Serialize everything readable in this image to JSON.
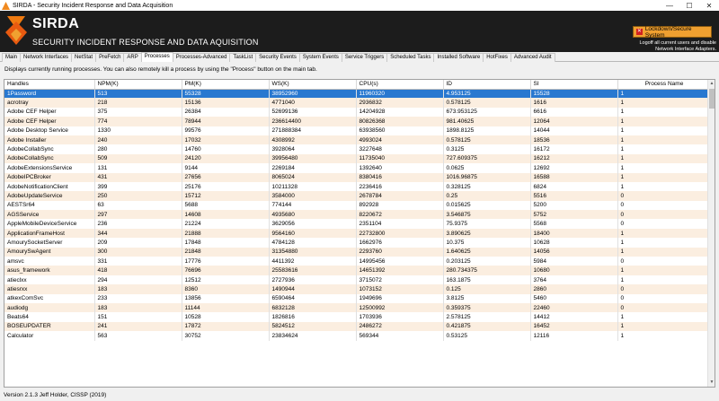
{
  "window": {
    "title": "SIRDA - Security Incident Response and Data Acquisition"
  },
  "header": {
    "brand": "SIRDA",
    "subtitle": "SECURITY INCIDENT RESPONSE AND DATA AQUISITION",
    "lockdown_label": "Lockdown/Secure System",
    "lockdown_info": "Logoff all current users and disable Network Interface Adapters."
  },
  "tabs": [
    "Main",
    "Network Interfaces",
    "NetStat",
    "PreFetch",
    "ARP",
    "Processes",
    "Processes-Advanced",
    "TaskList",
    "Security Events",
    "System Events",
    "Service Triggers",
    "Scheduled Tasks",
    "Installed Software",
    "HotFixes",
    "Advanced Audit"
  ],
  "active_tab": "Processes",
  "description": "Displays currently running processes. You can also remotely kill a process by using the \"Process\" button on the main tab.",
  "table": {
    "columns": [
      "Handles",
      "NPM(K)",
      "PM(K)",
      "WS(K)",
      "CPU(s)",
      "ID",
      "SI",
      "Process Name"
    ],
    "rows": [
      [
        "1Password",
        "513",
        "55328",
        "38952960",
        "11960320",
        "4.953125",
        "15528",
        "1"
      ],
      [
        "acrotray",
        "218",
        "15136",
        "4771040",
        "2936832",
        "0.578125",
        "1616",
        "1"
      ],
      [
        "Adobe CEF Helper",
        "375",
        "26384",
        "52699136",
        "14204928",
        "673.953125",
        "6616",
        "1"
      ],
      [
        "Adobe CEF Helper",
        "774",
        "78944",
        "236614400",
        "80826368",
        "981.40625",
        "12064",
        "1"
      ],
      [
        "Adobe Desktop Service",
        "1330",
        "99576",
        "271888384",
        "63938560",
        "1898.8125",
        "14044",
        "1"
      ],
      [
        "Adobe Installer",
        "240",
        "17032",
        "4308992",
        "4993024",
        "0.578125",
        "18536",
        "1"
      ],
      [
        "AdobeCollabSync",
        "280",
        "14760",
        "3928064",
        "3227648",
        "0.3125",
        "16172",
        "1"
      ],
      [
        "AdobeCollabSync",
        "509",
        "24120",
        "39956480",
        "11735040",
        "727.609375",
        "16212",
        "1"
      ],
      [
        "AdobeExtensionsService",
        "131",
        "9144",
        "2269184",
        "1392640",
        "0.0625",
        "12692",
        "1"
      ],
      [
        "AdobeIPCBroker",
        "431",
        "27656",
        "8065024",
        "8380416",
        "1016.96875",
        "16588",
        "1"
      ],
      [
        "AdobeNotificationClient",
        "399",
        "25176",
        "10211328",
        "2236416",
        "0.328125",
        "6824",
        "1"
      ],
      [
        "AdobeUpdateService",
        "250",
        "15712",
        "3584000",
        "2678784",
        "0.25",
        "5516",
        "0"
      ],
      [
        "AESTSr64",
        "63",
        "5688",
        "774144",
        "892928",
        "0.015625",
        "5200",
        "0"
      ],
      [
        "AGSService",
        "297",
        "14608",
        "4935680",
        "8220672",
        "3.546875",
        "5752",
        "0"
      ],
      [
        "AppleMobileDeviceService",
        "236",
        "21224",
        "3629056",
        "2351104",
        "75.9375",
        "5568",
        "0"
      ],
      [
        "ApplicationFrameHost",
        "344",
        "21888",
        "9564160",
        "22732800",
        "3.890625",
        "18400",
        "1"
      ],
      [
        "AmourySocketServer",
        "209",
        "17848",
        "4784128",
        "1662976",
        "10.375",
        "10628",
        "1"
      ],
      [
        "AmourySwAgent",
        "300",
        "21848",
        "31354880",
        "2293760",
        "1.640625",
        "14056",
        "1"
      ],
      [
        "amsvc",
        "331",
        "17776",
        "4411392",
        "14995456",
        "0.203125",
        "5984",
        "0"
      ],
      [
        "asus_framework",
        "418",
        "76696",
        "25583616",
        "14651392",
        "280.734375",
        "10680",
        "1"
      ],
      [
        "atieclxx",
        "294",
        "12512",
        "2727936",
        "3715072",
        "163.1875",
        "3764",
        "1"
      ],
      [
        "atiesrxx",
        "183",
        "8360",
        "1490944",
        "1073152",
        "0.125",
        "2860",
        "0"
      ],
      [
        "atkexComSvc",
        "233",
        "13856",
        "6590464",
        "1949696",
        "3.8125",
        "5460",
        "0"
      ],
      [
        "audiodg",
        "183",
        "11144",
        "6832128",
        "12500992",
        "0.359375",
        "22460",
        "0"
      ],
      [
        "Beats64",
        "151",
        "10528",
        "1826816",
        "1703936",
        "2.578125",
        "14412",
        "1"
      ],
      [
        "BOSEUPDATER",
        "241",
        "17872",
        "5824512",
        "2486272",
        "0.421875",
        "16452",
        "1"
      ],
      [
        "Calculator",
        "563",
        "30752",
        "23834624",
        "569344",
        "0.53125",
        "12116",
        "1"
      ]
    ]
  },
  "status": "Version 2.1.3  Jeff Holder, CISSP (2019)"
}
